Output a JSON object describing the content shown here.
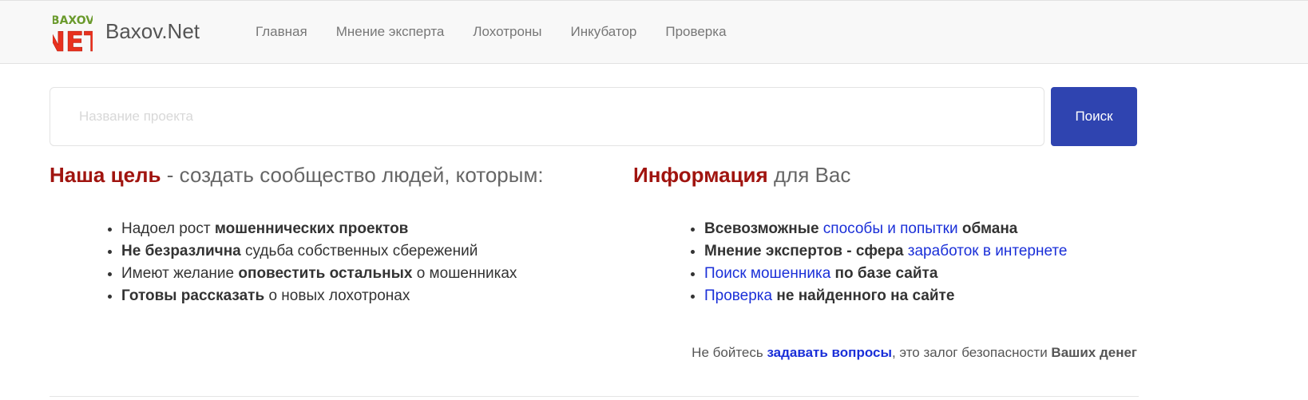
{
  "logo": {
    "top_text": "BAXOV",
    "bottom_text": "NET"
  },
  "header": {
    "brand": "Baxov.Net",
    "nav": [
      {
        "label": "Главная"
      },
      {
        "label": "Мнение эксперта"
      },
      {
        "label": "Лохотроны"
      },
      {
        "label": "Инкубатор"
      },
      {
        "label": "Проверка"
      }
    ]
  },
  "search": {
    "placeholder": "Название проекта",
    "value": "",
    "button_label": "Поиск"
  },
  "goal": {
    "title_accent": "Наша цель",
    "title_rest": " - создать сообщество людей, которым:",
    "items": [
      {
        "a": "Надоел рост ",
        "b": "мошеннических проектов",
        "c": ""
      },
      {
        "a": "",
        "b": "Не безразлична",
        "c": " судьба собственных сбережений"
      },
      {
        "a": "Имеют желание ",
        "b": "оповестить остальных",
        "c": " о мошенниках"
      },
      {
        "a": "",
        "b": "Готовы рассказать",
        "c": " о новых лохотронах"
      }
    ]
  },
  "info": {
    "title_accent": "Информация",
    "title_rest": " для Вас",
    "items": [
      {
        "pre": "Всевозможные ",
        "link": "способы и попытки",
        "post": " обмана"
      },
      {
        "pre": "Мнение экспертов - сфера ",
        "link": "заработок в интернете",
        "post": ""
      },
      {
        "pre": "",
        "link": "Поиск мошенника",
        "post": " по базе сайта"
      },
      {
        "pre": "",
        "link": "Проверка",
        "post": " не найденного на сайте"
      }
    ]
  },
  "notice": {
    "pre": "Не бойтесь ",
    "link": "задавать вопросы",
    "mid": ", это залог безопасности ",
    "bold": "Ваших денег"
  },
  "colors": {
    "accent_red": "#a0140f",
    "link_blue": "#1a2fd8",
    "button_blue": "#2f44b0"
  }
}
